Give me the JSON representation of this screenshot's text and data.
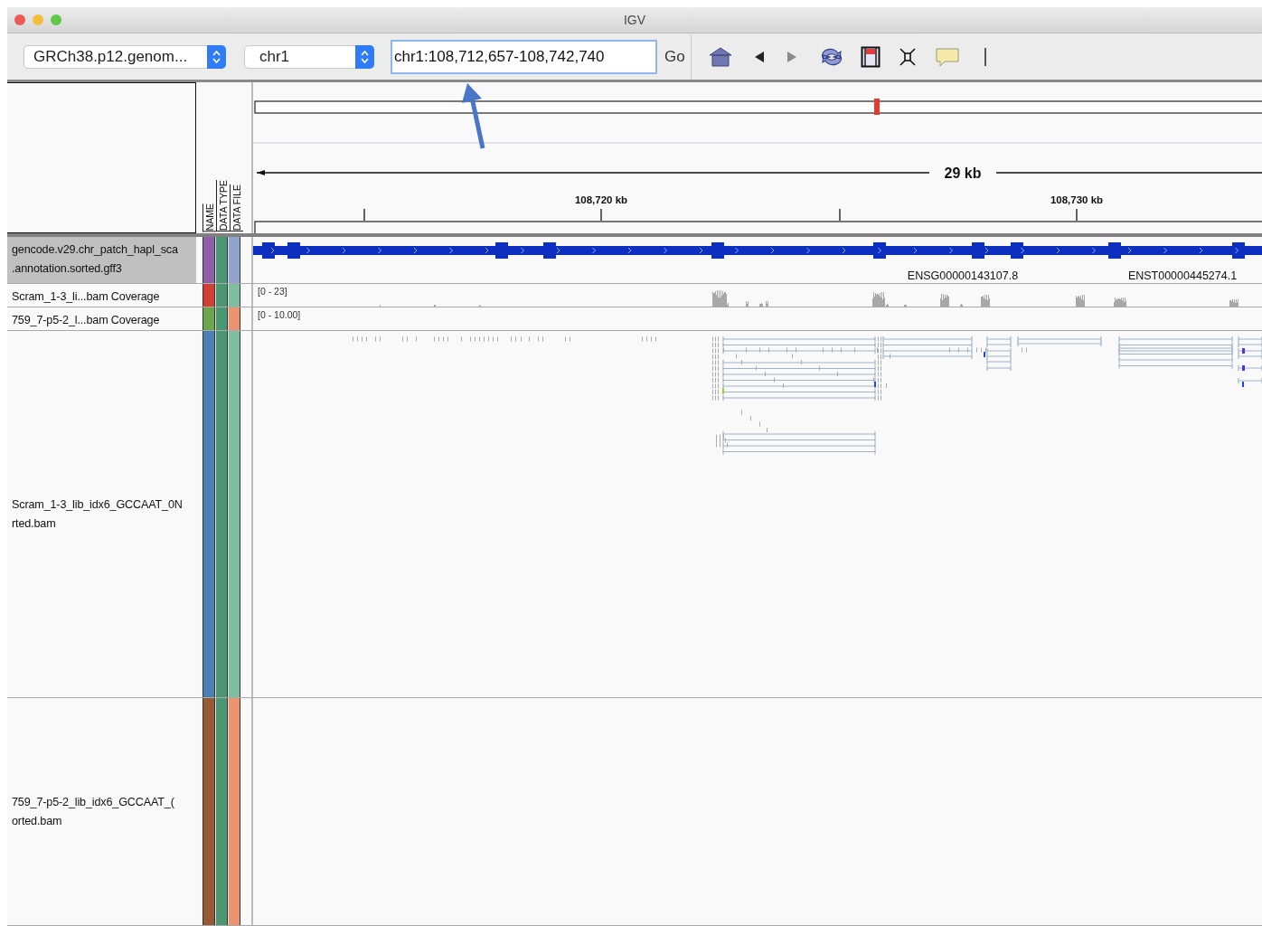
{
  "window": {
    "title": "IGV"
  },
  "toolbar": {
    "genome": "GRCh38.p12.genom...",
    "chromosome": "chr1",
    "locus": "chr1:108,712,657-108,742,740",
    "go": "Go",
    "forward_disabled": true
  },
  "attribute_headers": [
    "NAME",
    "DATA TYPE",
    "DATA FILE"
  ],
  "ruler": {
    "span": "29 kb",
    "ticks": [
      "108,720 kb",
      "108,730 kb"
    ]
  },
  "tracks": [
    {
      "kind": "gene",
      "name_lines": [
        "gencode.v29.chr_patch_hapl_sca",
        ".annotation.sorted.gff3"
      ],
      "selected": true,
      "attributes": [
        {
          "color": "#8e5ea6"
        },
        {
          "color": "#4b9673"
        },
        {
          "color": "#8fa3cc"
        }
      ],
      "features": [
        "ENSG00000143107.8",
        "ENST00000445274.1"
      ]
    },
    {
      "kind": "coverage",
      "name_lines": [
        "Scram_1-3_li...bam Coverage"
      ],
      "selected": false,
      "attributes": [
        {
          "color": "#d43f35"
        },
        {
          "color": "#4b9673"
        },
        {
          "color": "#7fbf9f"
        }
      ],
      "range": "[0 - 23]"
    },
    {
      "kind": "coverage",
      "name_lines": [
        "759_7-p5-2_l...bam Coverage"
      ],
      "selected": false,
      "attributes": [
        {
          "color": "#6aa74a"
        },
        {
          "color": "#4b9673"
        },
        {
          "color": "#ec9470"
        }
      ],
      "range": "[0 - 10.00]"
    },
    {
      "kind": "alignment",
      "name_lines": [
        "Scram_1-3_lib_idx6_GCCAAT_0N",
        "rted.bam"
      ],
      "selected": false,
      "attributes": [
        {
          "color": "#4a80b4"
        },
        {
          "color": "#4b9673"
        },
        {
          "color": "#7fbf9f"
        }
      ],
      "reads": true
    },
    {
      "kind": "alignment",
      "name_lines": [
        "759_7-p5-2_lib_idx6_GCCAAT_(",
        "orted.bam"
      ],
      "selected": false,
      "attributes": [
        {
          "color": "#985a34"
        },
        {
          "color": "#4b9673"
        },
        {
          "color": "#ec9470"
        }
      ],
      "reads": false
    }
  ]
}
